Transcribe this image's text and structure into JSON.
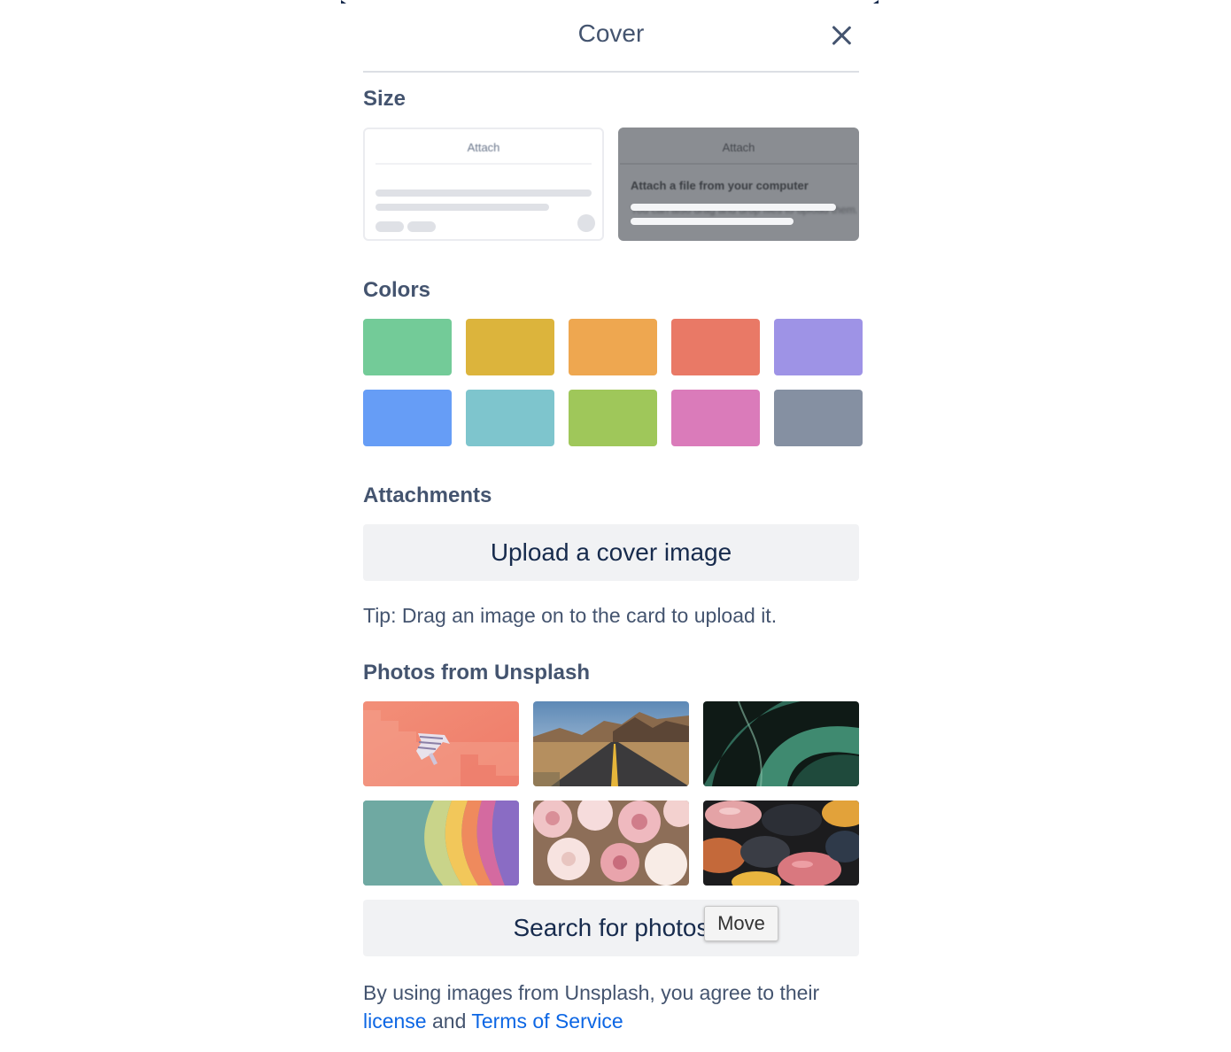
{
  "dialog": {
    "title": "Cover",
    "close_icon": "close-icon"
  },
  "size": {
    "heading": "Size",
    "card_label": "Attach",
    "full_card_text_1": "Attach a file from your computer",
    "full_card_text_2": "You can also drag and drop files to upload them."
  },
  "colors": {
    "heading": "Colors",
    "swatches": [
      "#73cb98",
      "#dcb43c",
      "#eea750",
      "#e97966",
      "#9e93e6",
      "#669df6",
      "#7ec5cd",
      "#9fc75a",
      "#da7bba",
      "#8590a2"
    ]
  },
  "attachments": {
    "heading": "Attachments",
    "upload_button": "Upload a cover image",
    "tip": "Tip: Drag an image on to the card to upload it."
  },
  "unsplash": {
    "heading": "Photos from Unsplash",
    "search_button": "Search for photos",
    "legal_prefix": "By using images from Unsplash, you agree to their",
    "license_link": "license",
    "legal_and": "and",
    "terms_link": "Terms of Service"
  },
  "tooltip": {
    "text": "Move"
  },
  "theme": {
    "link_color": "#0c66e4",
    "button_background": "#f1f2f4",
    "text_color": "#44546f"
  }
}
